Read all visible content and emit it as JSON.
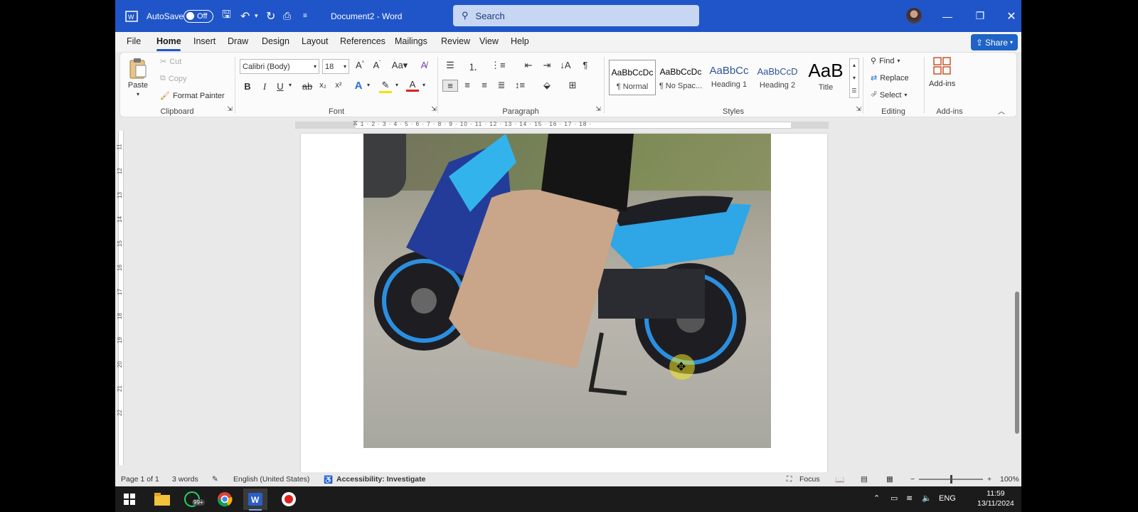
{
  "titlebar": {
    "autosave_label": "AutoSave",
    "autosave_state": "Off",
    "doc_title": "Document2  -  Word",
    "search_placeholder": "Search"
  },
  "menu": {
    "items": [
      "File",
      "Home",
      "Insert",
      "Draw",
      "Design",
      "Layout",
      "References",
      "Mailings",
      "Review",
      "View",
      "Help"
    ],
    "active": "Home",
    "share_label": "Share"
  },
  "ribbon": {
    "clipboard": {
      "paste": "Paste",
      "cut": "Cut",
      "copy": "Copy",
      "format_painter": "Format Painter",
      "label": "Clipboard"
    },
    "font": {
      "family": "Calibri (Body)",
      "size": "18",
      "label": "Font"
    },
    "paragraph": {
      "label": "Paragraph"
    },
    "styles": {
      "items": [
        {
          "preview": "AaBbCcDc",
          "name": "¶ Normal"
        },
        {
          "preview": "AaBbCcDc",
          "name": "¶ No Spac..."
        },
        {
          "preview": "AaBbCc",
          "name": "Heading 1"
        },
        {
          "preview": "AaBbCcD",
          "name": "Heading 2"
        },
        {
          "preview": "AaB",
          "name": "Title"
        }
      ],
      "label": "Styles"
    },
    "editing": {
      "find": "Find",
      "replace": "Replace",
      "select": "Select",
      "label": "Editing"
    },
    "addins": {
      "button": "Add-ins",
      "label": "Add-ins"
    }
  },
  "ruler": {
    "numbers": "· 1 · 2 · 3 · 4 · 5 · 6 · 7 · 8 · 9 · 10 · 11 · 12 · 13 · 14 · 15 · 16 · 17 · 18 ·"
  },
  "vruler": [
    "11",
    "12",
    "13",
    "14",
    "15",
    "16",
    "17",
    "18",
    "19",
    "20",
    "21",
    "22"
  ],
  "status": {
    "page": "Page 1 of 1",
    "words": "3 words",
    "language": "English (United States)",
    "accessibility": "Accessibility: Investigate",
    "focus": "Focus",
    "zoom": "100%"
  },
  "taskbar": {
    "badge": "99+",
    "lang": "ENG",
    "time": "11:59",
    "date": "13/11/2024"
  },
  "colors": {
    "titlebar": "#1f55c8",
    "accent": "#1f63c6"
  }
}
